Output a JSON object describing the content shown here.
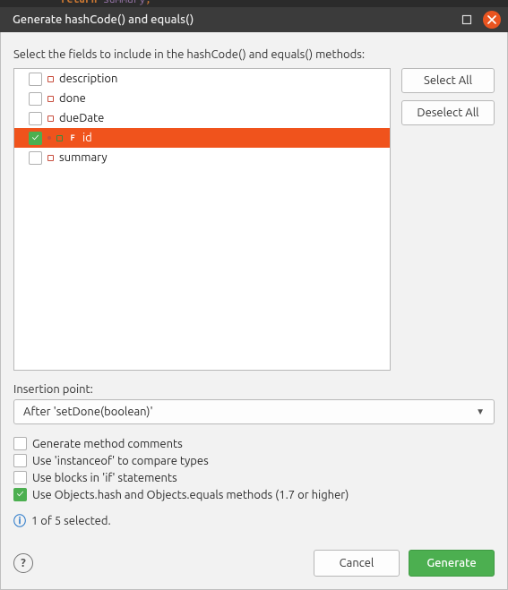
{
  "window": {
    "title": "Generate hashCode() and equals()"
  },
  "instruction": "Select the fields to include in the hashCode() and equals() methods:",
  "fields": [
    {
      "name": "description",
      "selected": false,
      "checked": false,
      "final": false
    },
    {
      "name": "done",
      "selected": false,
      "checked": false,
      "final": false
    },
    {
      "name": "dueDate",
      "selected": false,
      "checked": false,
      "final": false
    },
    {
      "name": "id",
      "selected": true,
      "checked": true,
      "final": true
    },
    {
      "name": "summary",
      "selected": false,
      "checked": false,
      "final": false
    }
  ],
  "buttons": {
    "select_all": "Select All",
    "deselect_all": "Deselect All",
    "cancel": "Cancel",
    "generate": "Generate"
  },
  "insertion": {
    "label": "Insertion point:",
    "value": "After 'setDone(boolean)'"
  },
  "options": [
    {
      "label": "Generate method comments",
      "checked": false
    },
    {
      "label": "Use 'instanceof' to compare types",
      "checked": false
    },
    {
      "label": "Use blocks in 'if' statements",
      "checked": false
    },
    {
      "label": "Use Objects.hash and Objects.equals methods (1.7 or higher)",
      "checked": true
    }
  ],
  "status": "1 of 5 selected.",
  "colors": {
    "selection": "#f0531c",
    "primary": "#4caf50",
    "close": "#e95420"
  }
}
